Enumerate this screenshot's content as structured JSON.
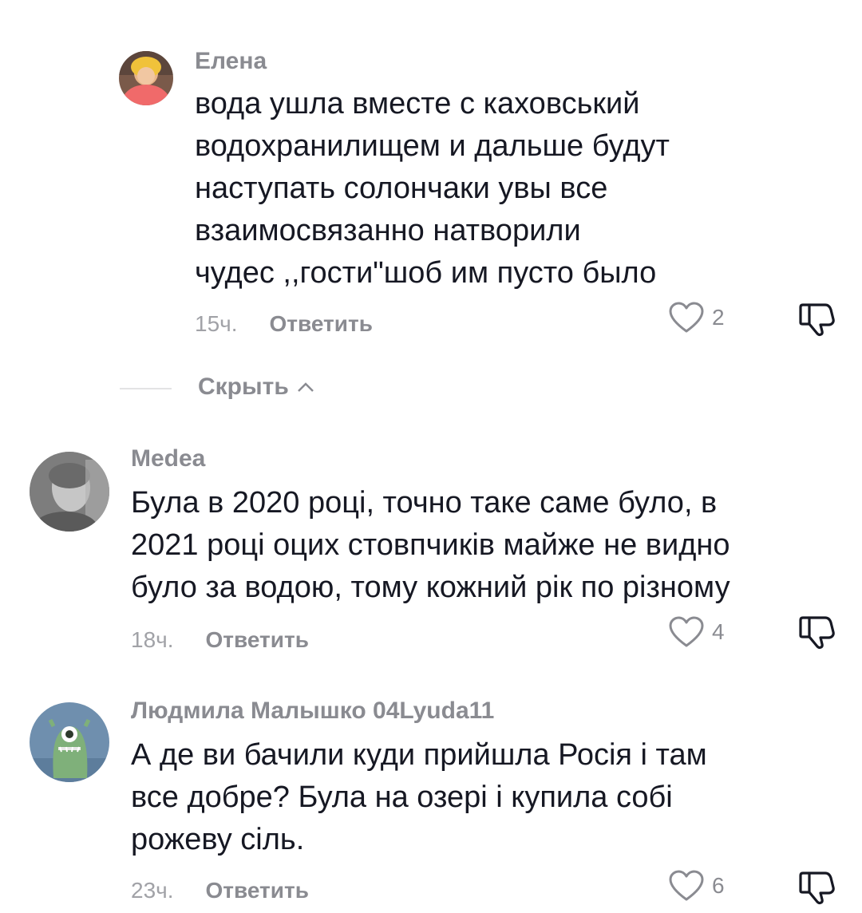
{
  "comments": [
    {
      "username": "Елена",
      "text": "вода ушла вместе с каховський\nводохранилищем и дальше будут\nнаступать солончаки увы все\nвзаимосвязанно натворили\nчудес ,,гости\"шоб им пусто было",
      "time": "15ч.",
      "reply_label": "Ответить",
      "likes": "2",
      "avatar_icon": "user-photo-avatar"
    },
    {
      "username": "Medea",
      "text": "Була в 2020 році, точно таке саме було, в\n2021 році оцих стовпчиків майже не видно\nбуло за водою, тому кожний рік по різному",
      "time": "18ч.",
      "reply_label": "Ответить",
      "likes": "4",
      "avatar_icon": "user-photo-avatar"
    },
    {
      "username": "Людмила  Малышко 04Lyuda11",
      "text": "А де ви бачили куди прийшла Росія і там\nвсе добре? Була на озері і купила собі\nрожеву сіль.",
      "time": "23ч.",
      "reply_label": "Ответить",
      "likes": "6",
      "avatar_icon": "cartoon-monster-avatar"
    }
  ],
  "hide_label": "Скрыть",
  "colors": {
    "text": "#161823",
    "muted": "#8a8b91",
    "time": "#a1a2a7"
  }
}
